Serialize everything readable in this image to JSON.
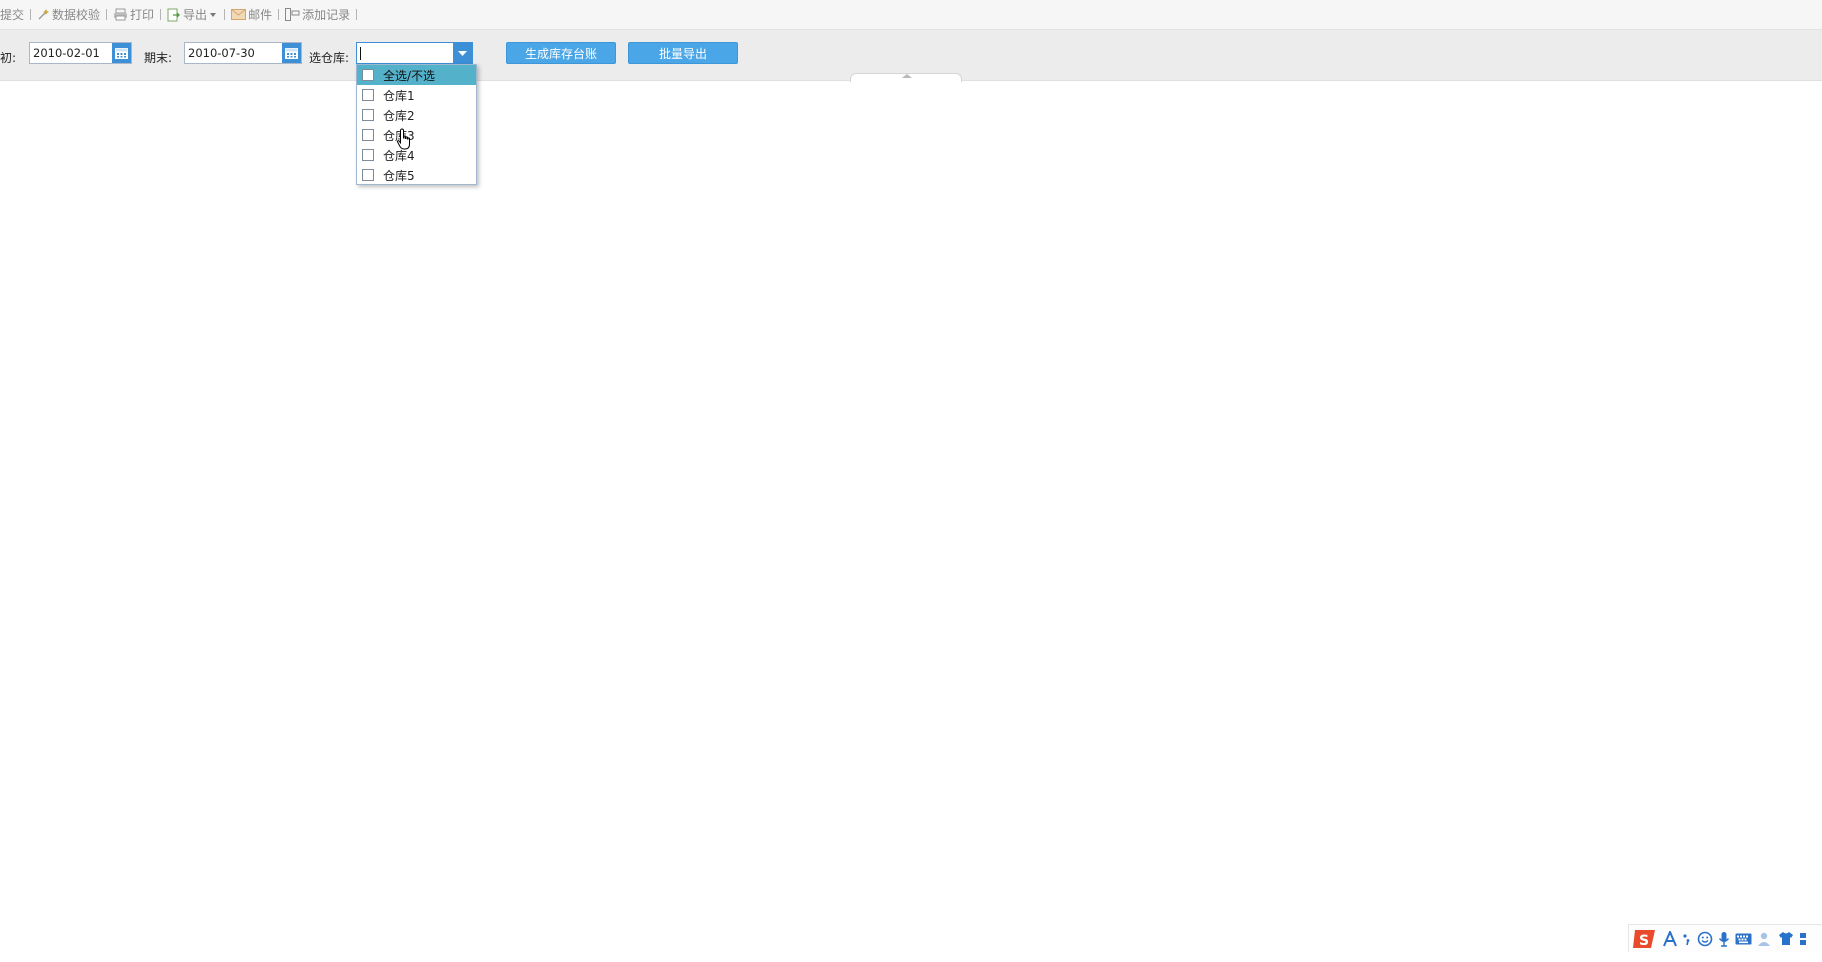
{
  "toolbar": {
    "items": [
      {
        "label": "提交",
        "icon": "submit-icon"
      },
      {
        "label": "数据校验",
        "icon": "wand-icon"
      },
      {
        "label": "打印",
        "icon": "printer-icon"
      },
      {
        "label": "导出",
        "icon": "export-icon",
        "has_dropdown": true
      },
      {
        "label": "邮件",
        "icon": "mail-icon"
      },
      {
        "label": "添加记录",
        "icon": "add-record-icon"
      }
    ]
  },
  "params": {
    "start_label": "初:",
    "start_value": "2010-02-01",
    "end_label": "期末:",
    "end_value": "2010-07-30",
    "warehouse_label": "选仓库:",
    "warehouse_value": "",
    "generate_button": "生成库存台账",
    "batch_export_button": "批量导出"
  },
  "dropdown": {
    "options": [
      {
        "label": "全选/不选",
        "checked": false,
        "highlighted": true
      },
      {
        "label": "仓库1",
        "checked": false
      },
      {
        "label": "仓库2",
        "checked": false
      },
      {
        "label": "仓库3",
        "checked": false
      },
      {
        "label": "仓库4",
        "checked": false
      },
      {
        "label": "仓库5",
        "checked": false
      }
    ]
  },
  "ime_tray": {
    "icons": [
      "sogou-logo-icon",
      "letter-a-icon",
      "punctuation-icon",
      "emoji-icon",
      "microphone-icon",
      "keyboard-icon",
      "user-icon",
      "skin-icon",
      "menu-icon"
    ]
  },
  "colors": {
    "accent": "#3d8fd6",
    "button": "#4aa6e7",
    "highlight": "#53b1c9",
    "ime_brand": "#e84a2b"
  }
}
